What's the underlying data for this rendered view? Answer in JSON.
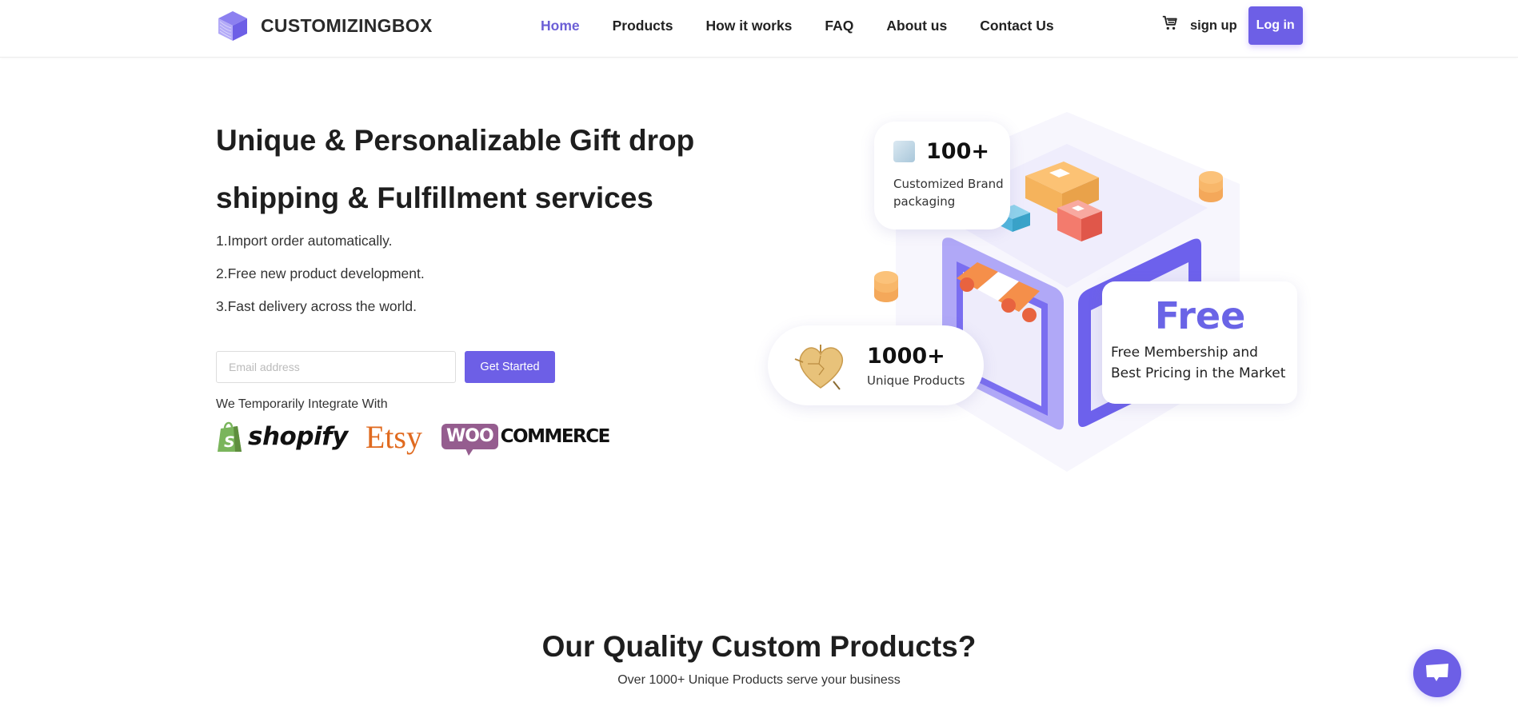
{
  "header": {
    "brand": "CUSTOMIZINGBOX",
    "nav": [
      {
        "label": "Home",
        "active": true
      },
      {
        "label": "Products",
        "active": false
      },
      {
        "label": "How it works",
        "active": false
      },
      {
        "label": "FAQ",
        "active": false
      },
      {
        "label": "About us",
        "active": false
      },
      {
        "label": "Contact Us",
        "active": false
      }
    ],
    "cart_icon": "cart-icon",
    "signup_label": "sign up",
    "login_label": "Log in"
  },
  "hero": {
    "title_line1": "Unique & Personalizable Gift drop",
    "title_line2": "shipping & Fulfillment services",
    "features": [
      "1.Import order automatically.",
      "2.Free new product development.",
      "3.Fast delivery across the world."
    ],
    "email_placeholder": "Email address",
    "email_value": "",
    "cta_label": "Get Started",
    "integrate_label": "We Temporarily Integrate With",
    "partners": {
      "shopify": "shopify",
      "etsy": "Etsy",
      "woo_bubble": "WOO",
      "woo_text": "COMMERCE"
    }
  },
  "illustration": {
    "brand_card": {
      "number": "100+",
      "desc_line1": "Customized Brand",
      "desc_line2": "packaging"
    },
    "products_card": {
      "number": "1000+",
      "desc": "Unique Products"
    },
    "free_card": {
      "headline": "Free",
      "desc_line1": "Free Membership and",
      "desc_line2": "Best Pricing in the Market"
    }
  },
  "section": {
    "title": "Our Quality Custom Products?",
    "subtitle": "Over 1000+ Unique Products serve your business"
  },
  "colors": {
    "accent": "#6d5fe6",
    "nav_active": "#6c5fd6",
    "etsy": "#e06a1f",
    "woo": "#955d8f",
    "shopify": "#7ab55c"
  }
}
